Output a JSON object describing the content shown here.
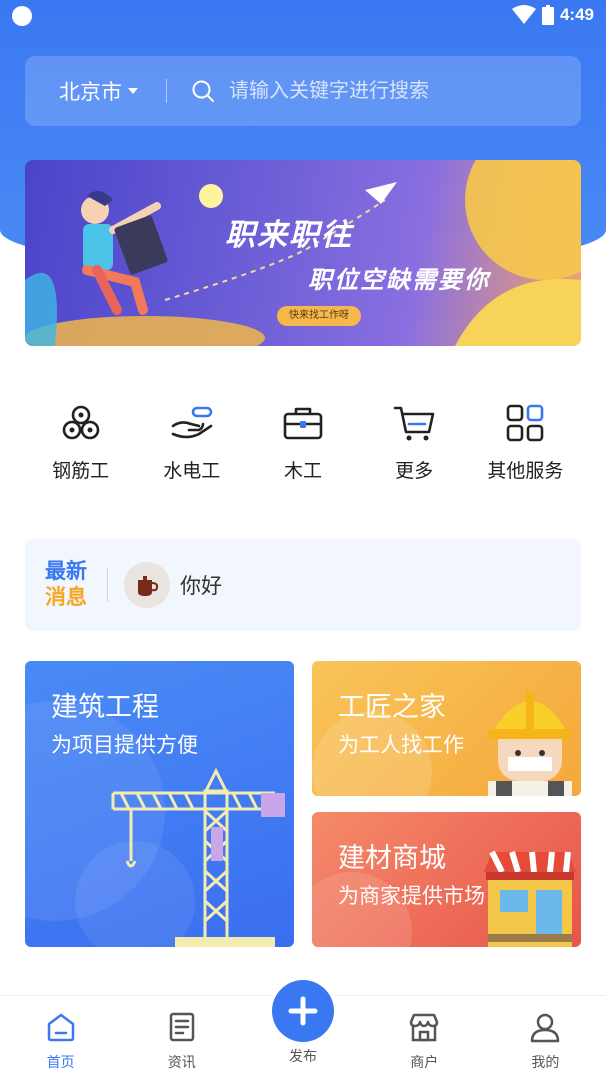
{
  "status_bar": {
    "time": "4:49"
  },
  "header": {
    "city": "北京市",
    "search_placeholder": "请输入关键字进行搜索"
  },
  "banner": {
    "title": "职来职往",
    "subtitle": "职位空缺需要你",
    "pill": "快来找工作呀"
  },
  "services": [
    {
      "label": "钢筋工",
      "icon": "rebar-icon"
    },
    {
      "label": "水电工",
      "icon": "hand-pipe-icon"
    },
    {
      "label": "木工",
      "icon": "toolbox-icon"
    },
    {
      "label": "更多",
      "icon": "cart-icon"
    },
    {
      "label": "其他服务",
      "icon": "grid-icon"
    }
  ],
  "news": {
    "tag_line1": "最新",
    "tag_line2": "消息",
    "text": "你好"
  },
  "cards": {
    "build": {
      "title": "建筑工程",
      "subtitle": "为项目提供方便"
    },
    "home": {
      "title": "工匠之家",
      "subtitle": "为工人找工作"
    },
    "mall": {
      "title": "建材商城",
      "subtitle": "为商家提供市场"
    }
  },
  "bottom_nav": {
    "home": "首页",
    "news": "资讯",
    "publish": "发布",
    "merchant": "商户",
    "mine": "我的"
  },
  "colors": {
    "primary": "#3a78f2",
    "accent_orange": "#f5a623"
  }
}
